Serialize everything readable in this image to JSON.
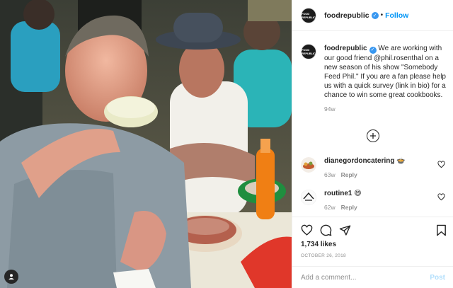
{
  "post": {
    "username": "foodrepublic",
    "avatar_text": "FOOD REPUBLIC",
    "follow_label": "Follow",
    "separator": "•"
  },
  "caption": {
    "username": "foodrepublic",
    "text": " We are working with our good friend @phil.rosenthal on a new season of his show \"Somebody Feed Phil.\" If you are a fan please help us with a quick survey (link in bio) for a chance to win some great cookbooks.",
    "time": "94w"
  },
  "comments": [
    {
      "username": "dianegordoncatering",
      "emoji": "🍲",
      "time": "63w",
      "reply_label": "Reply"
    },
    {
      "username": "routine1",
      "emoji": "😄",
      "time": "62w",
      "reply_label": "Reply"
    }
  ],
  "stats": {
    "likes": "1,734 likes",
    "date": "OCTOBER 26, 2018"
  },
  "add_comment": {
    "placeholder": "Add a comment...",
    "post_label": "Post"
  },
  "icons": [
    "user-tag-icon",
    "verified-icon",
    "heart-icon",
    "comment-icon",
    "share-icon",
    "bookmark-icon",
    "plus-circle-icon"
  ],
  "colors": {
    "accent": "#0095f6",
    "verified": "#3897f0",
    "muted": "#8e8e8e",
    "post_disabled": "#b2dffc"
  }
}
